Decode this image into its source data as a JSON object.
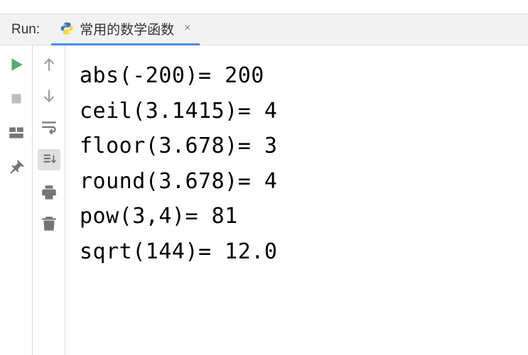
{
  "header": {
    "run_label": "Run:",
    "tab_title": "常用的数学函数",
    "tab_close": "×"
  },
  "output": {
    "lines": [
      "abs(-200)= 200",
      "ceil(3.1415)= 4",
      "floor(3.678)= 3",
      "round(3.678)= 4",
      "pow(3,4)= 81",
      "sqrt(144)= 12.0"
    ]
  },
  "icons": {
    "run": "run",
    "stop": "stop",
    "layout": "layout",
    "pin": "pin",
    "up": "up",
    "down": "down",
    "wrap": "wrap",
    "scroll": "scroll",
    "print": "print",
    "trash": "trash"
  }
}
